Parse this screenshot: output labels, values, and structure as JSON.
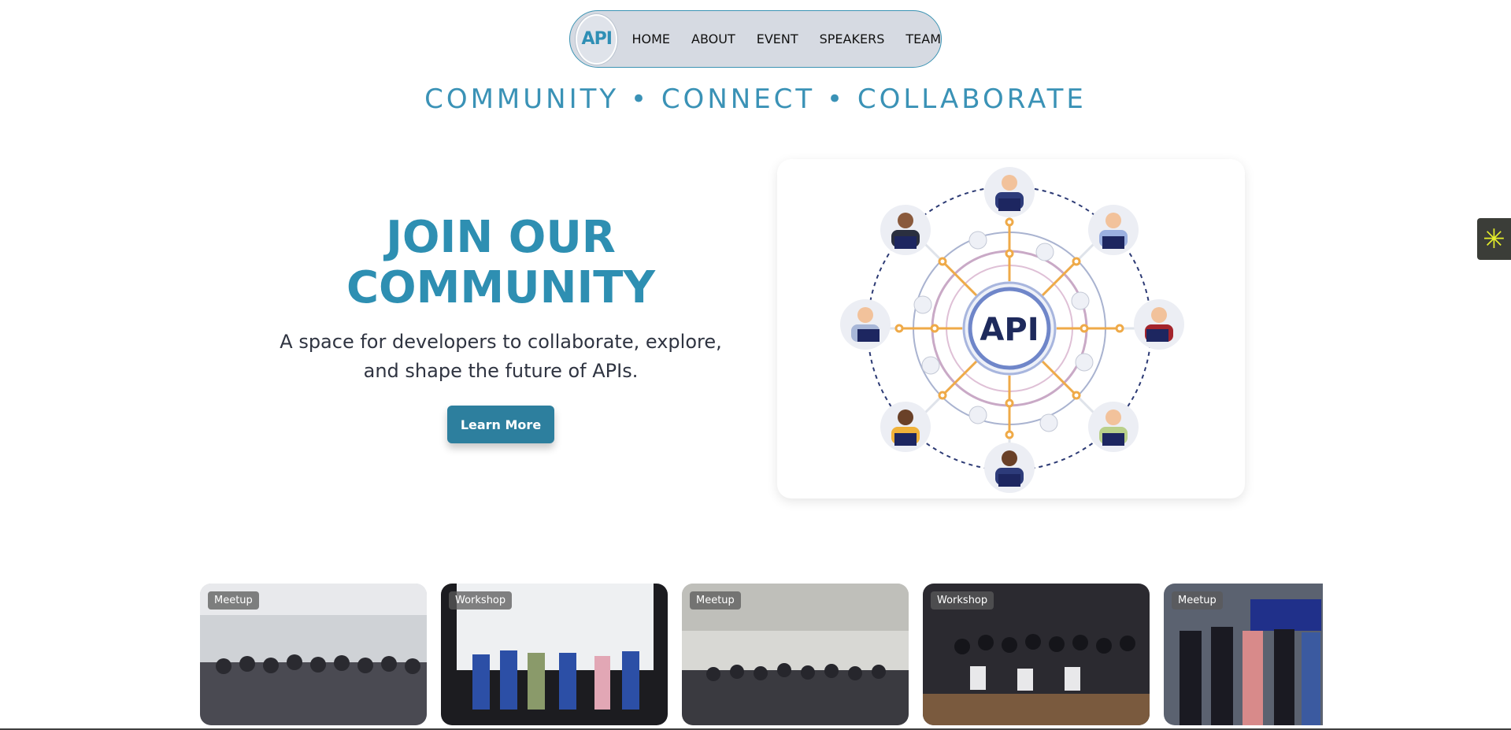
{
  "nav": {
    "logo_text": "API",
    "items": [
      "HOME",
      "ABOUT",
      "EVENT",
      "SPEAKERS",
      "TEAM"
    ]
  },
  "tagline": "COMMUNITY • CONNECT • COLLABORATE",
  "hero": {
    "title_line1": "JOIN OUR",
    "title_line2": "COMMUNITY",
    "subtitle_line1": "A space for developers to collaborate, explore,",
    "subtitle_line2": "and shape the future of APIs.",
    "button_label": "Learn More",
    "illustration_center_text": "API"
  },
  "gallery": {
    "cards": [
      {
        "badge": "Meetup"
      },
      {
        "badge": "Workshop"
      },
      {
        "badge": "Meetup"
      },
      {
        "badge": "Workshop"
      },
      {
        "badge": "Meetup"
      }
    ]
  },
  "colors": {
    "accent": "#2e8fb2",
    "button": "#2d7f9e",
    "nav_bg": "#d6dae2",
    "widget_bg": "#3b3d38",
    "widget_icon": "#e6f02a"
  },
  "icons": {
    "side_widget": "asterisk-icon"
  }
}
